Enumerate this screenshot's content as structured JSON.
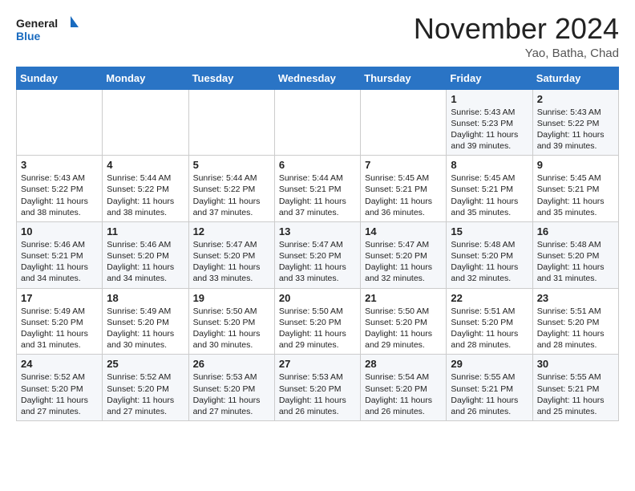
{
  "logo": {
    "line1": "General",
    "line2": "Blue"
  },
  "title": "November 2024",
  "subtitle": "Yao, Batha, Chad",
  "days_of_week": [
    "Sunday",
    "Monday",
    "Tuesday",
    "Wednesday",
    "Thursday",
    "Friday",
    "Saturday"
  ],
  "weeks": [
    [
      {
        "day": "",
        "info": ""
      },
      {
        "day": "",
        "info": ""
      },
      {
        "day": "",
        "info": ""
      },
      {
        "day": "",
        "info": ""
      },
      {
        "day": "",
        "info": ""
      },
      {
        "day": "1",
        "info": "Sunrise: 5:43 AM\nSunset: 5:23 PM\nDaylight: 11 hours and 39 minutes."
      },
      {
        "day": "2",
        "info": "Sunrise: 5:43 AM\nSunset: 5:22 PM\nDaylight: 11 hours and 39 minutes."
      }
    ],
    [
      {
        "day": "3",
        "info": "Sunrise: 5:43 AM\nSunset: 5:22 PM\nDaylight: 11 hours and 38 minutes."
      },
      {
        "day": "4",
        "info": "Sunrise: 5:44 AM\nSunset: 5:22 PM\nDaylight: 11 hours and 38 minutes."
      },
      {
        "day": "5",
        "info": "Sunrise: 5:44 AM\nSunset: 5:22 PM\nDaylight: 11 hours and 37 minutes."
      },
      {
        "day": "6",
        "info": "Sunrise: 5:44 AM\nSunset: 5:21 PM\nDaylight: 11 hours and 37 minutes."
      },
      {
        "day": "7",
        "info": "Sunrise: 5:45 AM\nSunset: 5:21 PM\nDaylight: 11 hours and 36 minutes."
      },
      {
        "day": "8",
        "info": "Sunrise: 5:45 AM\nSunset: 5:21 PM\nDaylight: 11 hours and 35 minutes."
      },
      {
        "day": "9",
        "info": "Sunrise: 5:45 AM\nSunset: 5:21 PM\nDaylight: 11 hours and 35 minutes."
      }
    ],
    [
      {
        "day": "10",
        "info": "Sunrise: 5:46 AM\nSunset: 5:21 PM\nDaylight: 11 hours and 34 minutes."
      },
      {
        "day": "11",
        "info": "Sunrise: 5:46 AM\nSunset: 5:20 PM\nDaylight: 11 hours and 34 minutes."
      },
      {
        "day": "12",
        "info": "Sunrise: 5:47 AM\nSunset: 5:20 PM\nDaylight: 11 hours and 33 minutes."
      },
      {
        "day": "13",
        "info": "Sunrise: 5:47 AM\nSunset: 5:20 PM\nDaylight: 11 hours and 33 minutes."
      },
      {
        "day": "14",
        "info": "Sunrise: 5:47 AM\nSunset: 5:20 PM\nDaylight: 11 hours and 32 minutes."
      },
      {
        "day": "15",
        "info": "Sunrise: 5:48 AM\nSunset: 5:20 PM\nDaylight: 11 hours and 32 minutes."
      },
      {
        "day": "16",
        "info": "Sunrise: 5:48 AM\nSunset: 5:20 PM\nDaylight: 11 hours and 31 minutes."
      }
    ],
    [
      {
        "day": "17",
        "info": "Sunrise: 5:49 AM\nSunset: 5:20 PM\nDaylight: 11 hours and 31 minutes."
      },
      {
        "day": "18",
        "info": "Sunrise: 5:49 AM\nSunset: 5:20 PM\nDaylight: 11 hours and 30 minutes."
      },
      {
        "day": "19",
        "info": "Sunrise: 5:50 AM\nSunset: 5:20 PM\nDaylight: 11 hours and 30 minutes."
      },
      {
        "day": "20",
        "info": "Sunrise: 5:50 AM\nSunset: 5:20 PM\nDaylight: 11 hours and 29 minutes."
      },
      {
        "day": "21",
        "info": "Sunrise: 5:50 AM\nSunset: 5:20 PM\nDaylight: 11 hours and 29 minutes."
      },
      {
        "day": "22",
        "info": "Sunrise: 5:51 AM\nSunset: 5:20 PM\nDaylight: 11 hours and 28 minutes."
      },
      {
        "day": "23",
        "info": "Sunrise: 5:51 AM\nSunset: 5:20 PM\nDaylight: 11 hours and 28 minutes."
      }
    ],
    [
      {
        "day": "24",
        "info": "Sunrise: 5:52 AM\nSunset: 5:20 PM\nDaylight: 11 hours and 27 minutes."
      },
      {
        "day": "25",
        "info": "Sunrise: 5:52 AM\nSunset: 5:20 PM\nDaylight: 11 hours and 27 minutes."
      },
      {
        "day": "26",
        "info": "Sunrise: 5:53 AM\nSunset: 5:20 PM\nDaylight: 11 hours and 27 minutes."
      },
      {
        "day": "27",
        "info": "Sunrise: 5:53 AM\nSunset: 5:20 PM\nDaylight: 11 hours and 26 minutes."
      },
      {
        "day": "28",
        "info": "Sunrise: 5:54 AM\nSunset: 5:20 PM\nDaylight: 11 hours and 26 minutes."
      },
      {
        "day": "29",
        "info": "Sunrise: 5:55 AM\nSunset: 5:21 PM\nDaylight: 11 hours and 26 minutes."
      },
      {
        "day": "30",
        "info": "Sunrise: 5:55 AM\nSunset: 5:21 PM\nDaylight: 11 hours and 25 minutes."
      }
    ]
  ]
}
